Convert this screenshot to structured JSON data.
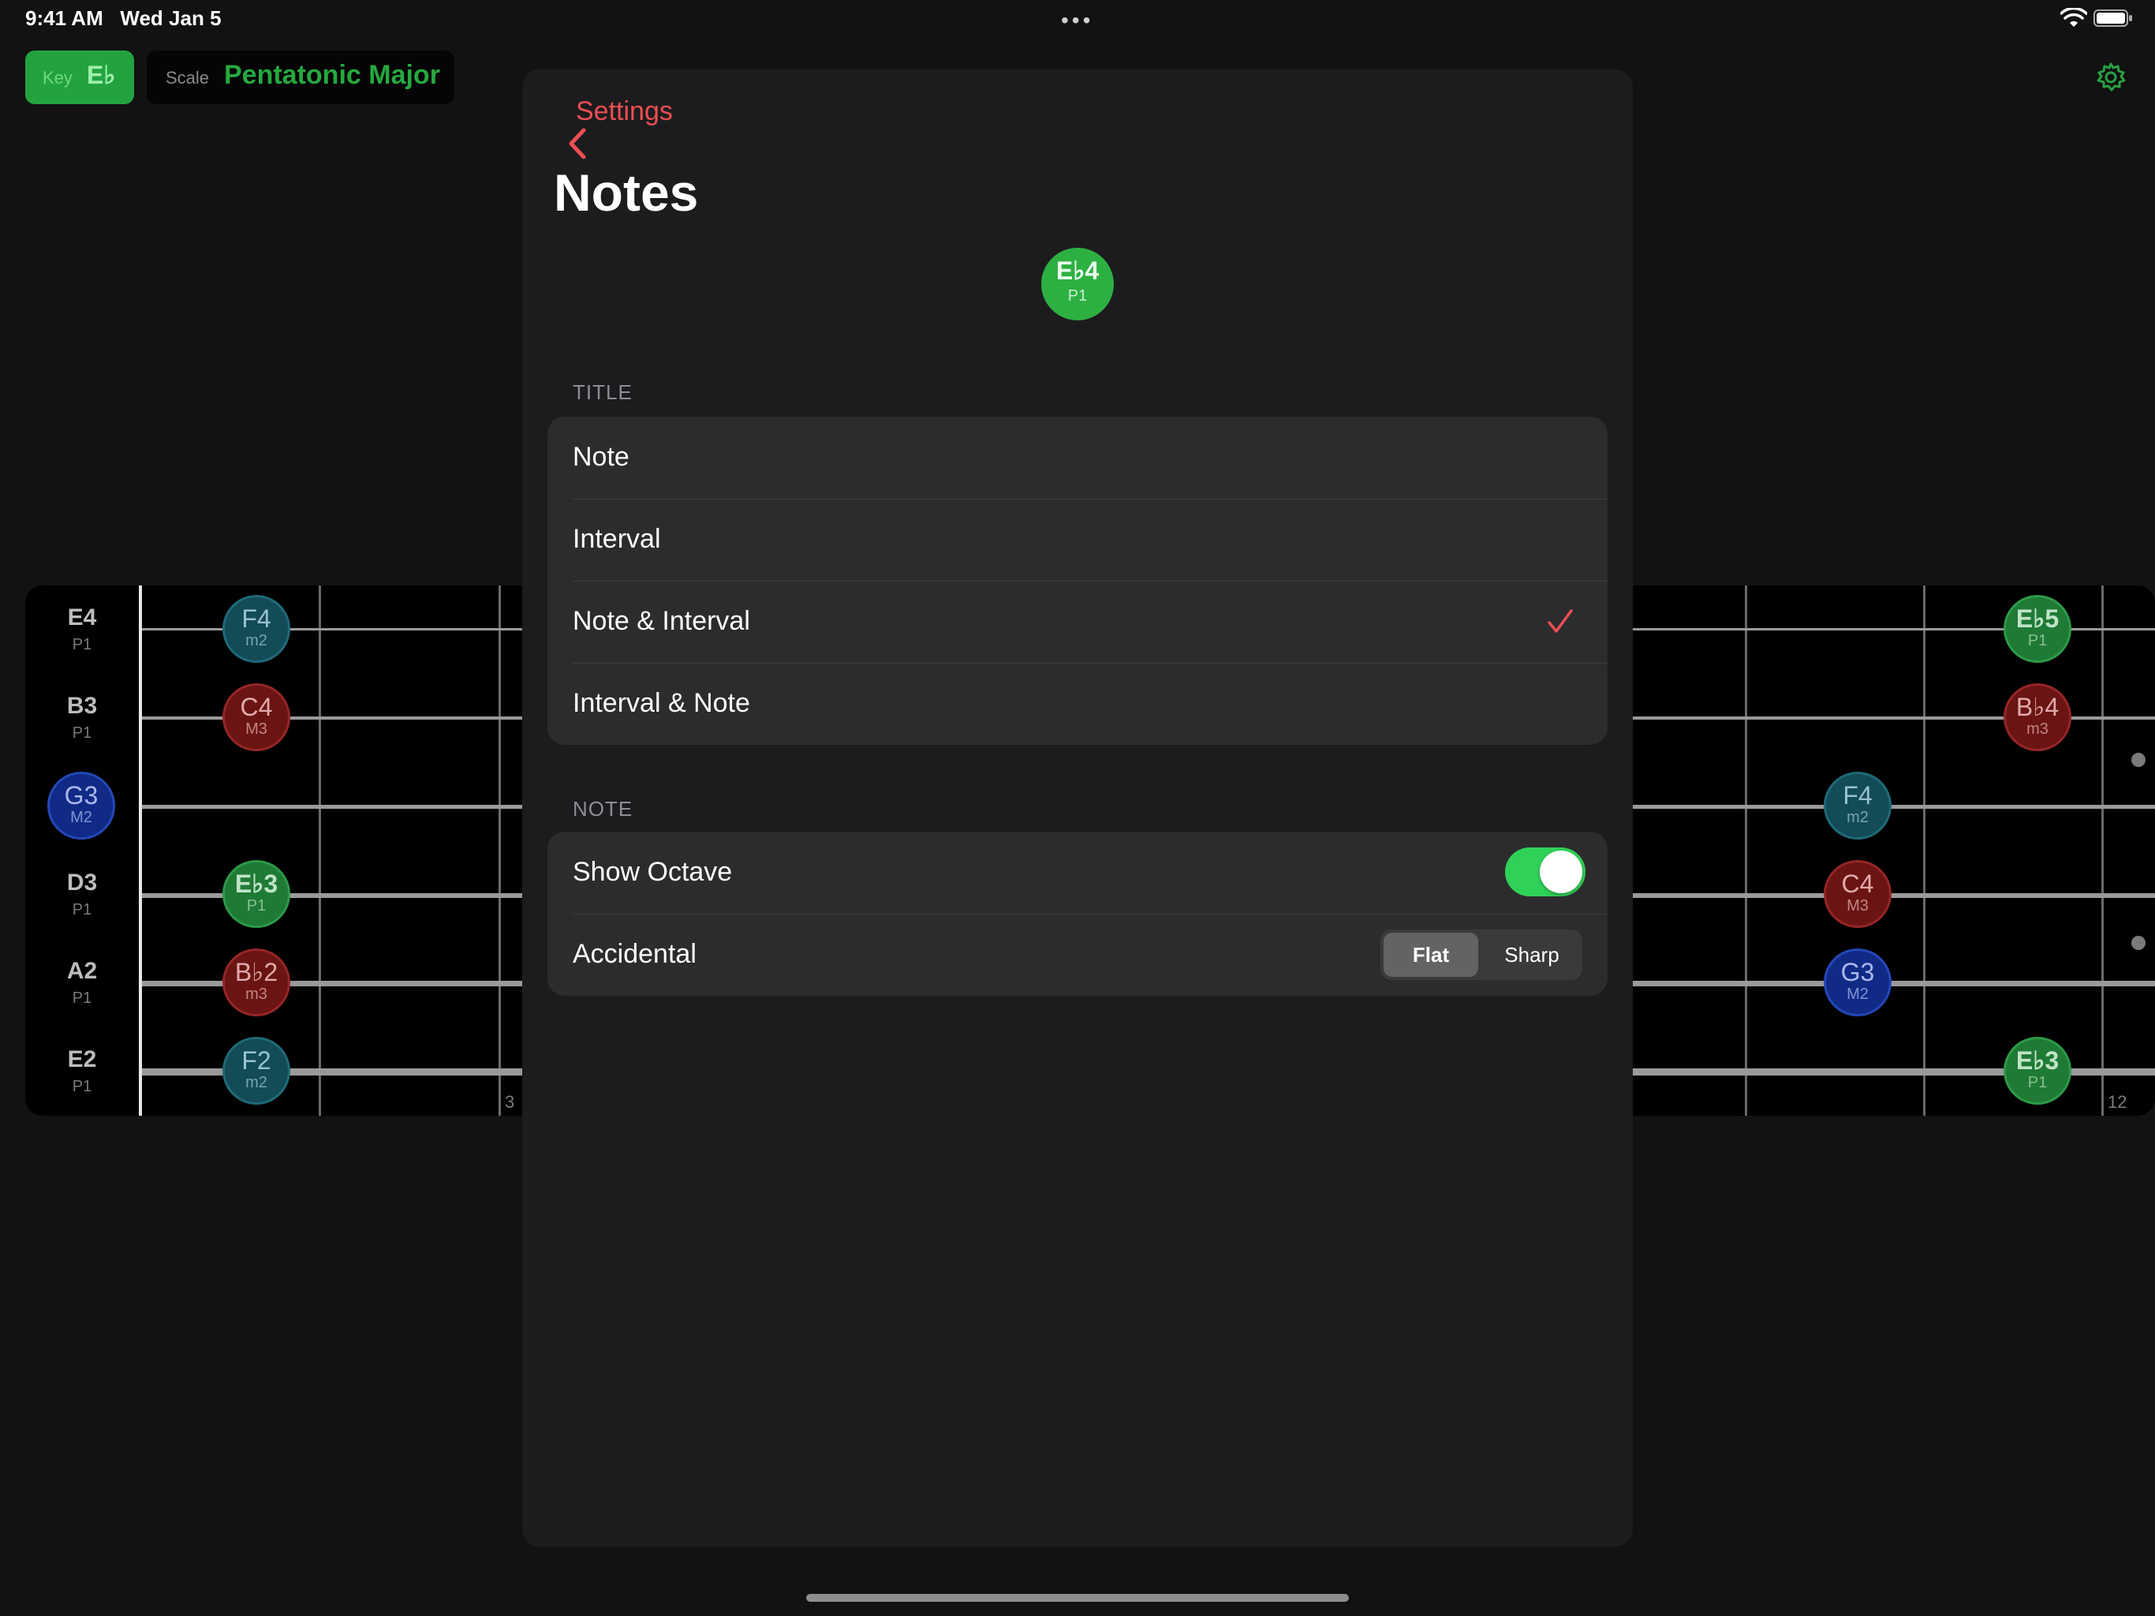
{
  "status_bar": {
    "time": "9:41 AM",
    "date": "Wed Jan 5",
    "multitask_dots": "•••"
  },
  "toolbar": {
    "key_label": "Key",
    "key_value": "E♭",
    "scale_label": "Scale",
    "scale_value": "Pentatonic Major",
    "settings_icon": "gear-icon"
  },
  "fretboard": {
    "open_strings": [
      {
        "note": "E4",
        "interval": "P1"
      },
      {
        "note": "B3",
        "interval": "P1"
      },
      {
        "note": "G3",
        "interval": "M2"
      },
      {
        "note": "D3",
        "interval": "P1"
      },
      {
        "note": "A2",
        "interval": "P1"
      },
      {
        "note": "E2",
        "interval": "P1"
      }
    ],
    "fret_numbers": [
      "3",
      "12"
    ],
    "notes": [
      {
        "note": "F4",
        "interval": "m2"
      },
      {
        "note": "C4",
        "interval": "M3"
      },
      {
        "note": "E♭3",
        "interval": "P1"
      },
      {
        "note": "B♭2",
        "interval": "m3"
      },
      {
        "note": "F2",
        "interval": "m2"
      },
      {
        "note": "E♭5",
        "interval": "P1"
      },
      {
        "note": "B♭4",
        "interval": "m3"
      },
      {
        "note": "F4",
        "interval": "m2"
      },
      {
        "note": "C4",
        "interval": "M3"
      },
      {
        "note": "G3",
        "interval": "M2"
      },
      {
        "note": "E♭3",
        "interval": "P1"
      }
    ]
  },
  "sheet": {
    "back_label": "Settings",
    "title": "Notes",
    "preview": {
      "note": "E♭4",
      "interval": "P1"
    },
    "title_section": {
      "header": "TITLE",
      "options": [
        "Note",
        "Interval",
        "Note & Interval",
        "Interval & Note"
      ],
      "selected": "Note & Interval"
    },
    "note_section": {
      "header": "NOTE",
      "show_octave_label": "Show Octave",
      "show_octave_on": true,
      "accidental_label": "Accidental",
      "accidental_options": [
        "Flat",
        "Sharp"
      ],
      "accidental_selected": "Flat"
    }
  },
  "colors": {
    "accent_red": "#ec4e52",
    "toggle_green": "#30d158",
    "p1_green": "#1f7a35",
    "m2_teal": "#134b57",
    "M2_blue": "#102a86",
    "M3_red": "#6b1414"
  }
}
